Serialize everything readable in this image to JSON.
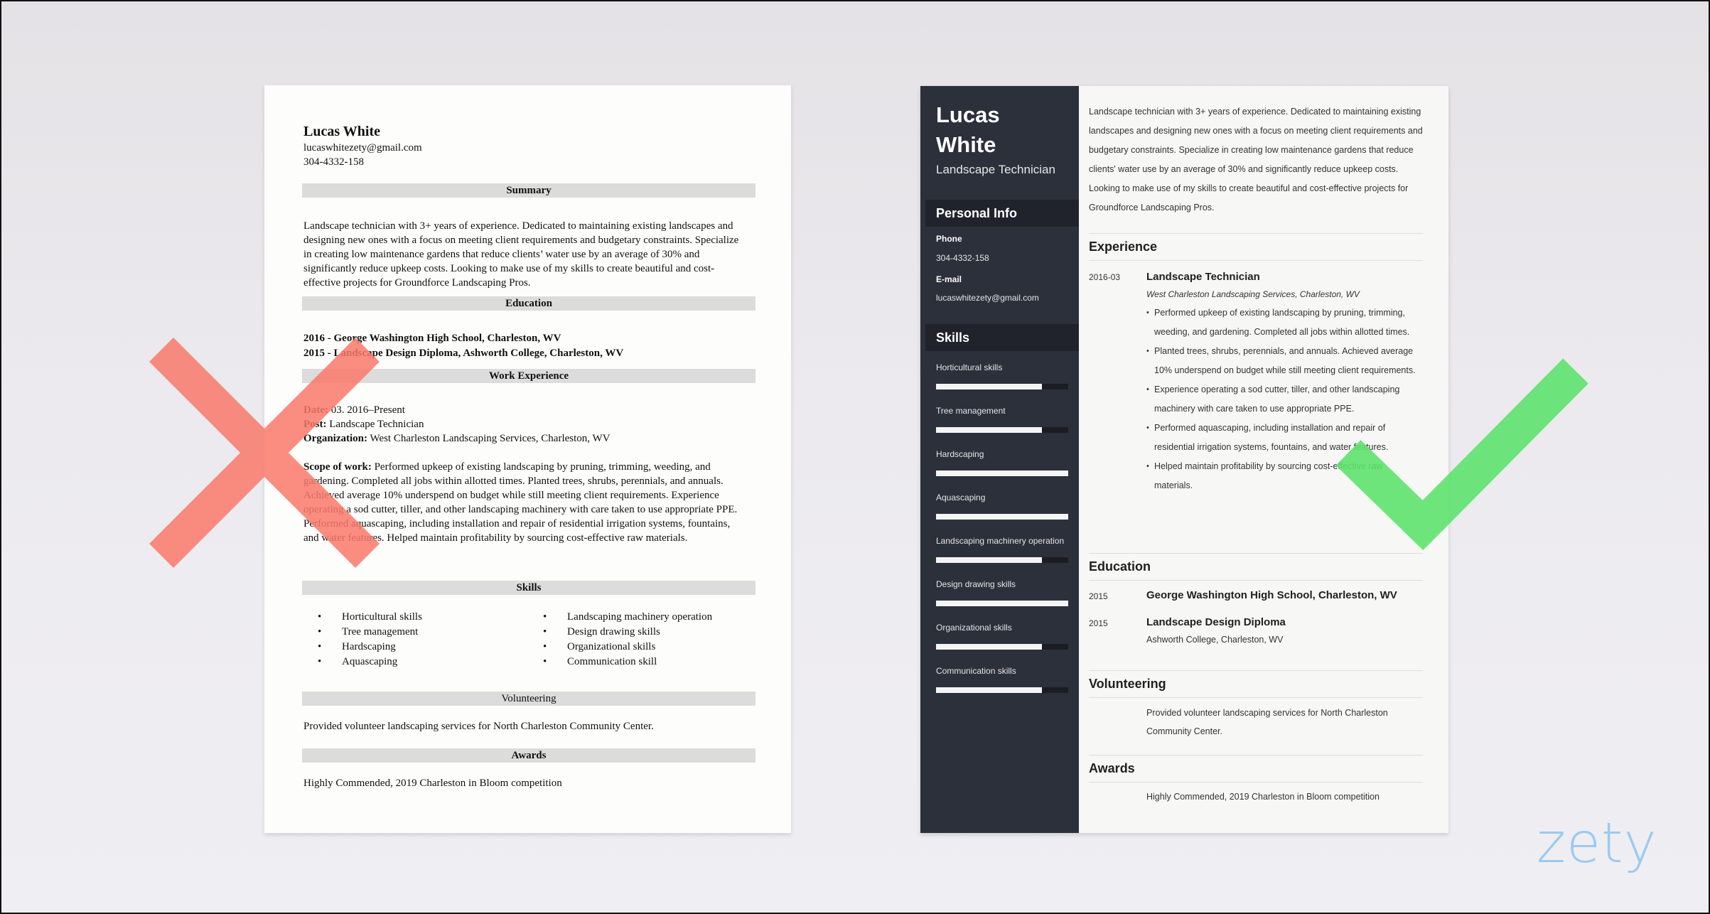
{
  "brand": {
    "logo_text": "zety",
    "logo_color": "#9ccaf0"
  },
  "marks": {
    "bad_color": "#fa7a6b",
    "good_color": "#5ee26e",
    "bad_label": "incorrect",
    "good_label": "correct"
  },
  "left_resume": {
    "name": "Lucas White",
    "email": "lucaswhitezety@gmail.com",
    "phone": "304-4332-158",
    "sections": {
      "summary": "Summary",
      "education": "Education",
      "work": "Work Experience",
      "skills": "Skills",
      "volunteering": "Volunteering",
      "awards": "Awards"
    },
    "summary_text": "Landscape technician with 3+ years of experience. Dedicated to maintaining existing landscapes and designing new ones with a focus on meeting client requirements and budgetary constraints. Specialize in creating low maintenance gardens that reduce clients’ water use by an average of 30% and significantly reduce upkeep costs. Looking to make use of my skills to create beautiful and cost-effective projects for Groundforce Landscaping Pros.",
    "education": [
      "2016 - George Washington High School, Charleston, WV",
      "2015 - Landscape Design Diploma, Ashworth College, Charleston, WV"
    ],
    "work": {
      "date_label": "Date:",
      "date_value": "03. 2016–Present",
      "post_label": "Post:",
      "post_value": "Landscape Technician",
      "org_label": "Organization:",
      "org_value": "West Charleston Landscaping Services, Charleston, WV",
      "scope_label": "Scope of work:",
      "scope_text": "Performed upkeep of existing landscaping by pruning, trimming, weeding, and gardening. Completed all jobs within allotted times. Planted trees, shrubs, perennials, and annuals. Achieved average 10% underspend on budget while still meeting client requirements. Experience operating a sod cutter, tiller, and other landscaping machinery with care taken to use appropriate PPE.",
      "scope_text_2": "Performed aquascaping, including installation and repair of residential irrigation systems, fountains, and water features. Helped maintain profitability by sourcing cost-effective raw materials."
    },
    "skills_col1": [
      "Horticultural skills",
      "Tree management",
      "Hardscaping",
      "Aquascaping"
    ],
    "skills_col2": [
      "Landscaping machinery operation",
      "Design drawing skills",
      "Organizational skills",
      "Communication skill"
    ],
    "volunteering_text": "Provided volunteer landscaping services for North Charleston Community Center.",
    "awards_text": "Highly Commended, 2019 Charleston in Bloom competition"
  },
  "right_resume": {
    "first_name": "Lucas",
    "last_name": "White",
    "title": "Landscape Technician",
    "personal_info_heading": "Personal Info",
    "phone_label": "Phone",
    "phone": "304-4332-158",
    "email_label": "E-mail",
    "email": "lucaswhitezety@gmail.com",
    "skills_heading": "Skills",
    "skills": [
      {
        "name": "Horticultural skills",
        "level": 0.8
      },
      {
        "name": "Tree management",
        "level": 0.8
      },
      {
        "name": "Hardscaping",
        "level": 1.0
      },
      {
        "name": "Aquascaping",
        "level": 1.0
      },
      {
        "name": "Landscaping machinery operation",
        "level": 0.8
      },
      {
        "name": "Design drawing skills",
        "level": 1.0
      },
      {
        "name": "Organizational skills",
        "level": 0.8
      },
      {
        "name": "Communication skills",
        "level": 0.8
      }
    ],
    "summary": "Landscape technician with 3+ years of experience. Dedicated to maintaining existing landscapes and designing new ones with a focus on meeting client requirements and budgetary constraints. Specialize in creating low maintenance gardens that reduce clients' water use by an average of 30% and significantly reduce upkeep costs. Looking to make use of my skills to create beautiful and cost-effective projects for Groundforce Landscaping Pros.",
    "experience_heading": "Experience",
    "job": {
      "date": "2016-03",
      "title": "Landscape Technician",
      "company": "West Charleston Landscaping Services, Charleston, WV",
      "bullets": [
        "Performed upkeep of existing landscaping by pruning, trimming, weeding, and gardening. Completed all jobs within allotted times.",
        "Planted trees, shrubs, perennials, and annuals. Achieved average 10% underspend on budget while still meeting client requirements.",
        "Experience operating a sod cutter, tiller, and other landscaping machinery with care taken to use appropriate PPE.",
        "Performed aquascaping, including installation and repair of residential irrigation systems, fountains, and water features.",
        "Helped maintain profitability by sourcing cost-effective raw materials."
      ]
    },
    "education_heading": "Education",
    "education": [
      {
        "year": "2015",
        "title": "George Washington High School, Charleston, WV",
        "sub": ""
      },
      {
        "year": "2015",
        "title": "Landscape Design Diploma",
        "sub": "Ashworth College, Charleston, WV"
      }
    ],
    "volunteering_heading": "Volunteering",
    "volunteering_text": "Provided volunteer landscaping services for North Charleston Community Center.",
    "awards_heading": "Awards",
    "awards_text": "Highly Commended, 2019 Charleston in Bloom competition"
  }
}
